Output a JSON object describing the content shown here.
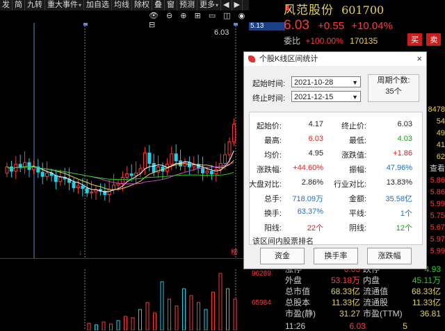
{
  "toolbar": {
    "items": [
      "发",
      "简",
      "九转",
      "重大事件",
      "加自选",
      "均线",
      "除权",
      "叠",
      "窗",
      "预测",
      "更多"
    ],
    "scroll_left": "◀",
    "scroll_right": "▶"
  },
  "chart": {
    "price_label": "6.03",
    "marker_left": "↓",
    "marker_right": "榜"
  },
  "quote": {
    "code_box": "5.13",
    "stock_name": "风范股份",
    "stock_code": "601700",
    "price": "6.03",
    "change": "+0.55",
    "change_pct": "+10.04%",
    "weibi_label": "委比",
    "weibi_value": "+100.00%",
    "weibi_volume": "170135",
    "buy_label": "买",
    "sell_label": "卖",
    "side_numbers": [
      "8478",
      "54",
      "49",
      "41",
      "62",
      "查看",
      "5.86",
      "5.86",
      "5.99",
      "5.75",
      "5.67",
      "5.97",
      "5.99"
    ]
  },
  "bottom": {
    "vol_a": "96289",
    "vol_b": "65984",
    "rows": [
      {
        "l1": "涨停",
        "v1": "6.03",
        "l2": "跌停",
        "v2": "4.93"
      },
      {
        "l1": "外盘",
        "v1": "53.18万",
        "l2": "内盘",
        "v2": "45.11万"
      },
      {
        "l1": "总市值",
        "v1": "68.33亿",
        "l2": "流通值",
        "v2": "68.33亿"
      },
      {
        "l1": "总股本",
        "v1": "11.33亿",
        "l2": "流通股",
        "v2": "11.33亿"
      },
      {
        "l1": "市盈(静)",
        "v1": "31.27",
        "l2": "市盈(TTM)",
        "v2": "36.81"
      }
    ],
    "time": "11:26",
    "time_price": "6.03",
    "time_vol": "5"
  },
  "dialog": {
    "title": "个股K线区间统计",
    "close": "×",
    "start_label": "起始时间:",
    "start_value": "2021-10-28",
    "end_label": "终止时间:",
    "end_value": "2021-12-15",
    "period_label": "周期个数:",
    "period_value": "35个",
    "stats": [
      {
        "l": "起始价:",
        "v": "4.17",
        "c": "black",
        "l2": "终止价:",
        "v2": "6.03",
        "c2": "black"
      },
      {
        "l": "最高:",
        "v": "6.03",
        "c": "red",
        "l2": "最低:",
        "v2": "4.03",
        "c2": "green"
      },
      {
        "l": "均价:",
        "v": "4.95",
        "c": "black",
        "l2": "涨跌值:",
        "v2": "+1.86",
        "c2": "red"
      },
      {
        "l": "涨跌幅:",
        "v": "+44.60%",
        "c": "red",
        "l2": "振幅:",
        "v2": "47.96%",
        "c2": "blue"
      },
      {
        "l": "大盘对比:",
        "v": "2.86%",
        "c": "black",
        "l2": "行业对比:",
        "v2": "13.83%",
        "c2": "black"
      },
      {
        "l": "总手:",
        "v": "718.09万",
        "c": "blue",
        "l2": "金额:",
        "v2": "35.58亿",
        "c2": "blue"
      },
      {
        "l": "换手:",
        "v": "63.37%",
        "c": "blue",
        "l2": "平线:",
        "v2": "1个",
        "c2": "blue"
      },
      {
        "l": "阳线:",
        "v": "22个",
        "c": "red",
        "l2": "阴线:",
        "v2": "12个",
        "c2": "green"
      }
    ],
    "rank_label": "该区间内股票排名",
    "buttons": [
      "资金",
      "换手率",
      "涨跌幅"
    ]
  },
  "colors": {
    "up": "#ff3c3c",
    "down": "#22d1e8",
    "ma5": "#ffffff",
    "ma10": "#e8d34b",
    "ma20": "#d04fd0",
    "ma60": "#22d11f"
  }
}
